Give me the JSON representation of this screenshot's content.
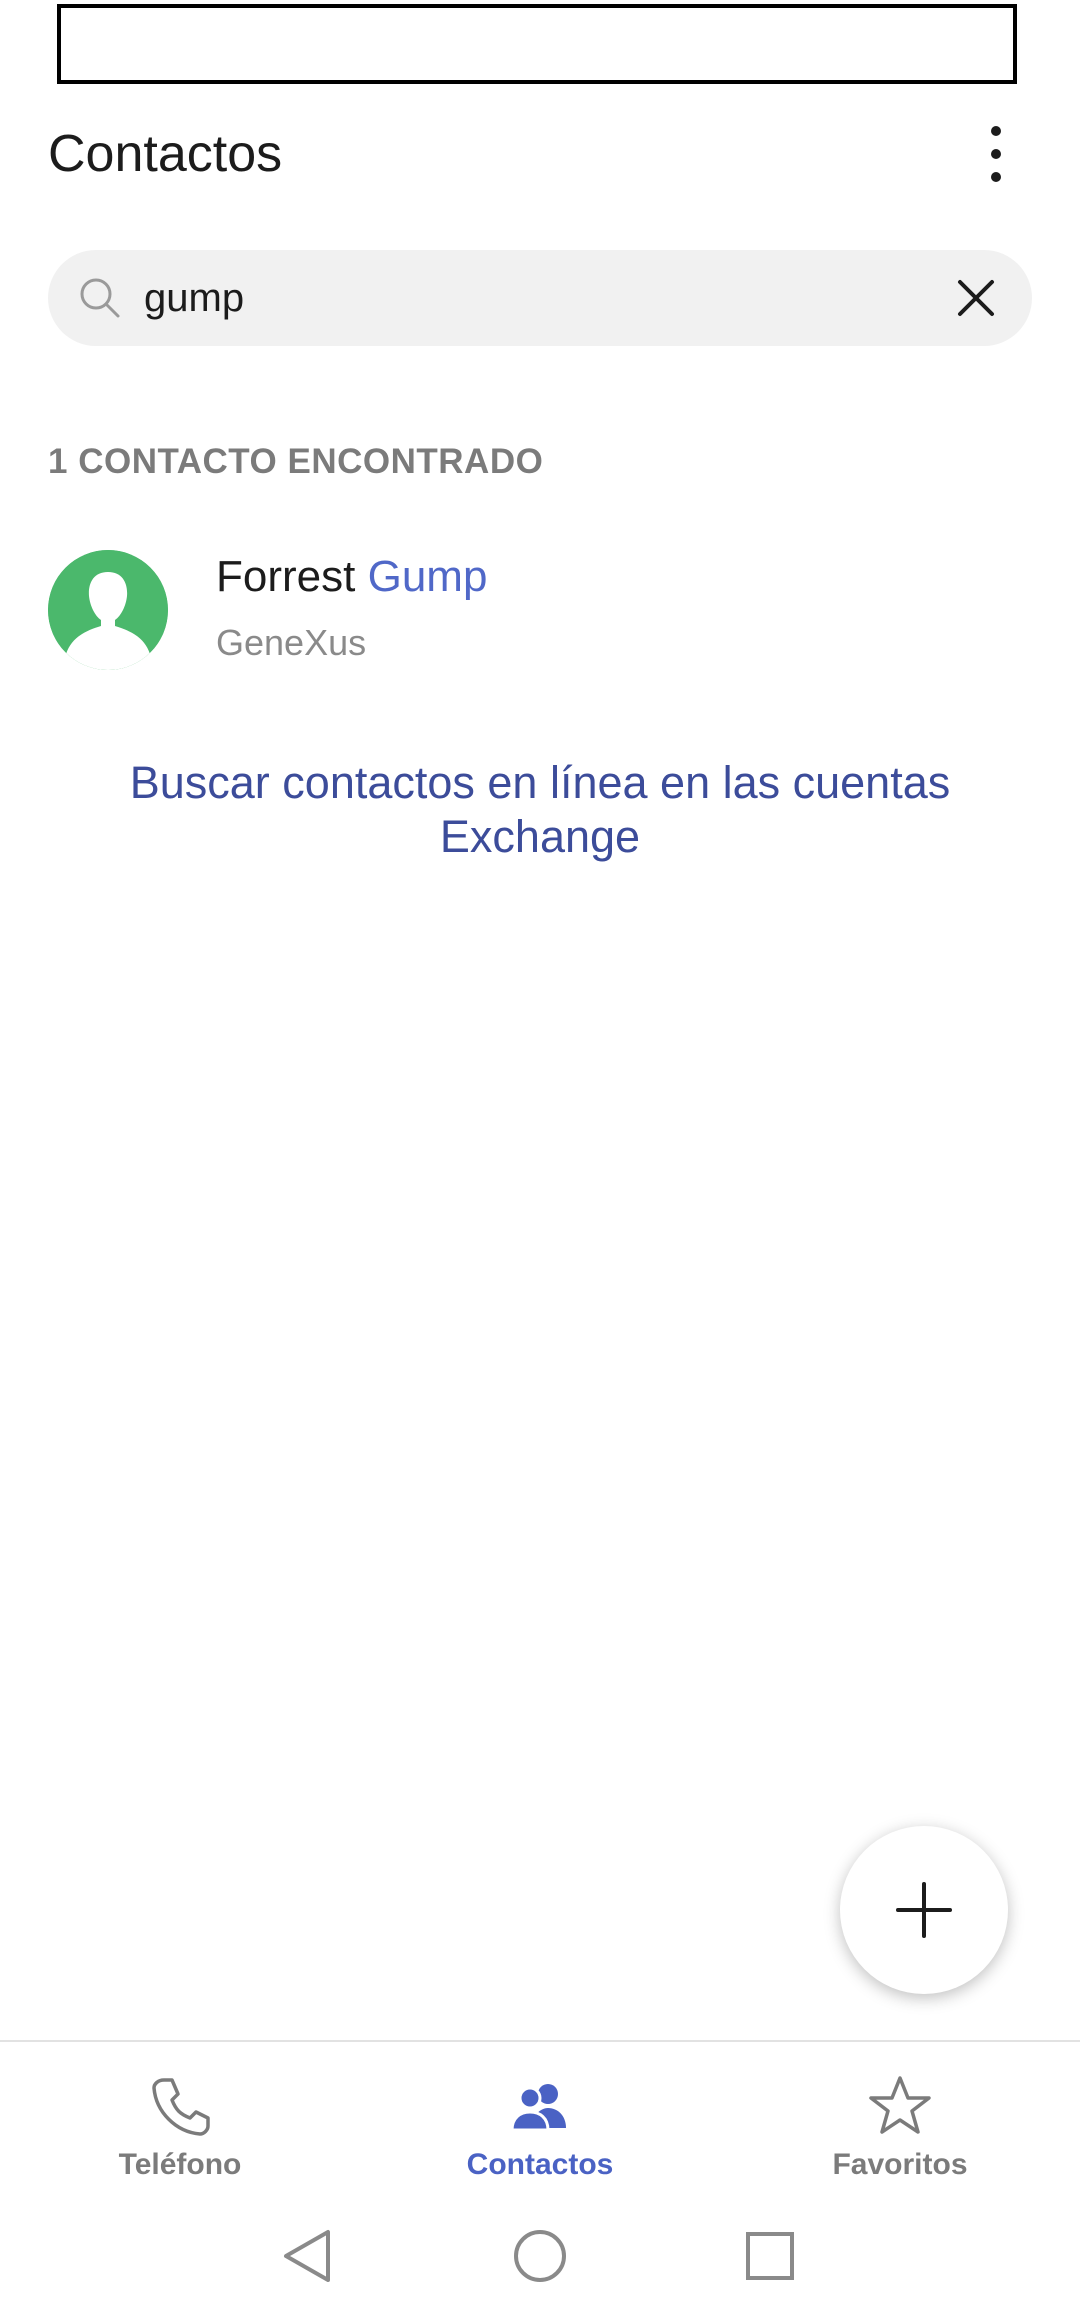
{
  "header": {
    "title": "Contactos",
    "more_icon": "more-vertical-icon"
  },
  "search": {
    "value": "gump",
    "placeholder": "",
    "search_icon": "search-icon",
    "clear_icon": "close-icon"
  },
  "results": {
    "count_label": "1 CONTACTO ENCONTRADO",
    "contacts": [
      {
        "first_name": "Forrest",
        "last_name": "Gump",
        "company": "GeneXus",
        "avatar_icon": "person-avatar-icon",
        "avatar_color": "#4bb86c"
      }
    ]
  },
  "exchange_link": "Buscar contactos en línea en las cuentas Exchange",
  "fab": {
    "icon": "plus-icon"
  },
  "bottom_nav": {
    "items": [
      {
        "label": "Teléfono",
        "icon": "phone-icon",
        "active": false
      },
      {
        "label": "Contactos",
        "icon": "people-icon",
        "active": true
      },
      {
        "label": "Favoritos",
        "icon": "star-icon",
        "active": false
      }
    ]
  },
  "system_nav": {
    "back_icon": "back-triangle-icon",
    "home_icon": "home-circle-icon",
    "recents_icon": "recents-square-icon"
  },
  "colors": {
    "accent": "#4a62c4",
    "link": "#3c4c9a",
    "highlight": "#5068c8",
    "muted_text": "#7b7b7b",
    "search_bg": "#f1f1f1"
  }
}
